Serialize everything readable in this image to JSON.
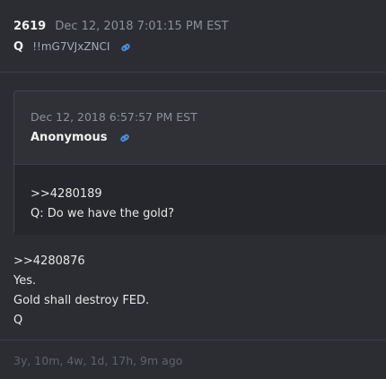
{
  "post": {
    "number": "2619",
    "date": "Dec 12, 2018 7:01:15 PM EST",
    "author": "Q",
    "tripcode": "!!mG7VJxZNCI",
    "link_icon": "link-icon",
    "lines": [
      ">>4280876",
      "Yes.",
      "Gold shall destroy FED.",
      "Q"
    ],
    "time_ago": "3y, 10m, 4w, 1d, 17h, 9m ago"
  },
  "quote": {
    "date": "Dec 12, 2018 6:57:57 PM EST",
    "author": "Anonymous",
    "link_icon": "link-icon",
    "lines": [
      ">>4280189",
      "Q: Do we have the gold?"
    ]
  },
  "colors": {
    "background": "#2b2d33",
    "text": "#e6e6e6",
    "muted": "#8c9099",
    "link": "#4a90e2"
  }
}
